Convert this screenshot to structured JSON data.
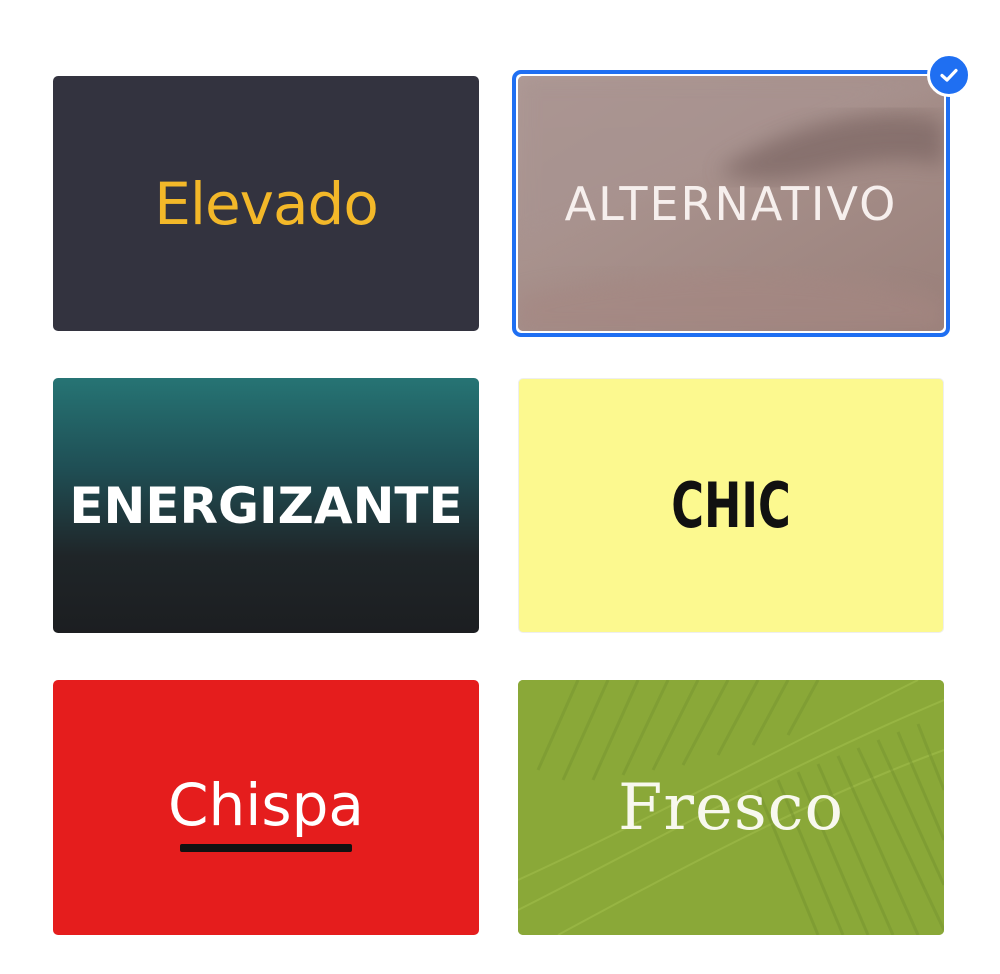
{
  "themes": [
    {
      "id": "elevado",
      "label": "Elevado",
      "text_color": "#f3b829",
      "background": "#33333f",
      "selected": false
    },
    {
      "id": "alternativo",
      "label": "ALTERNATIVO",
      "text_color": "#f6efed",
      "background": "#a48f8b",
      "selected": true
    },
    {
      "id": "energizante",
      "label": "ENERGIZANTE",
      "text_color": "#ffffff",
      "background": "#1f2528",
      "selected": false
    },
    {
      "id": "chic",
      "label": "CHIC",
      "text_color": "#111111",
      "background": "#fcf98f",
      "selected": false
    },
    {
      "id": "chispa",
      "label": "Chispa",
      "text_color": "#ffffff",
      "background": "#e51d1d",
      "selected": false
    },
    {
      "id": "fresco",
      "label": "Fresco",
      "text_color": "#f8f8ee",
      "background": "#8aa838",
      "selected": false
    }
  ],
  "selection": {
    "accent_color": "#1f6ff2",
    "indicator_icon": "checkmark-icon"
  }
}
